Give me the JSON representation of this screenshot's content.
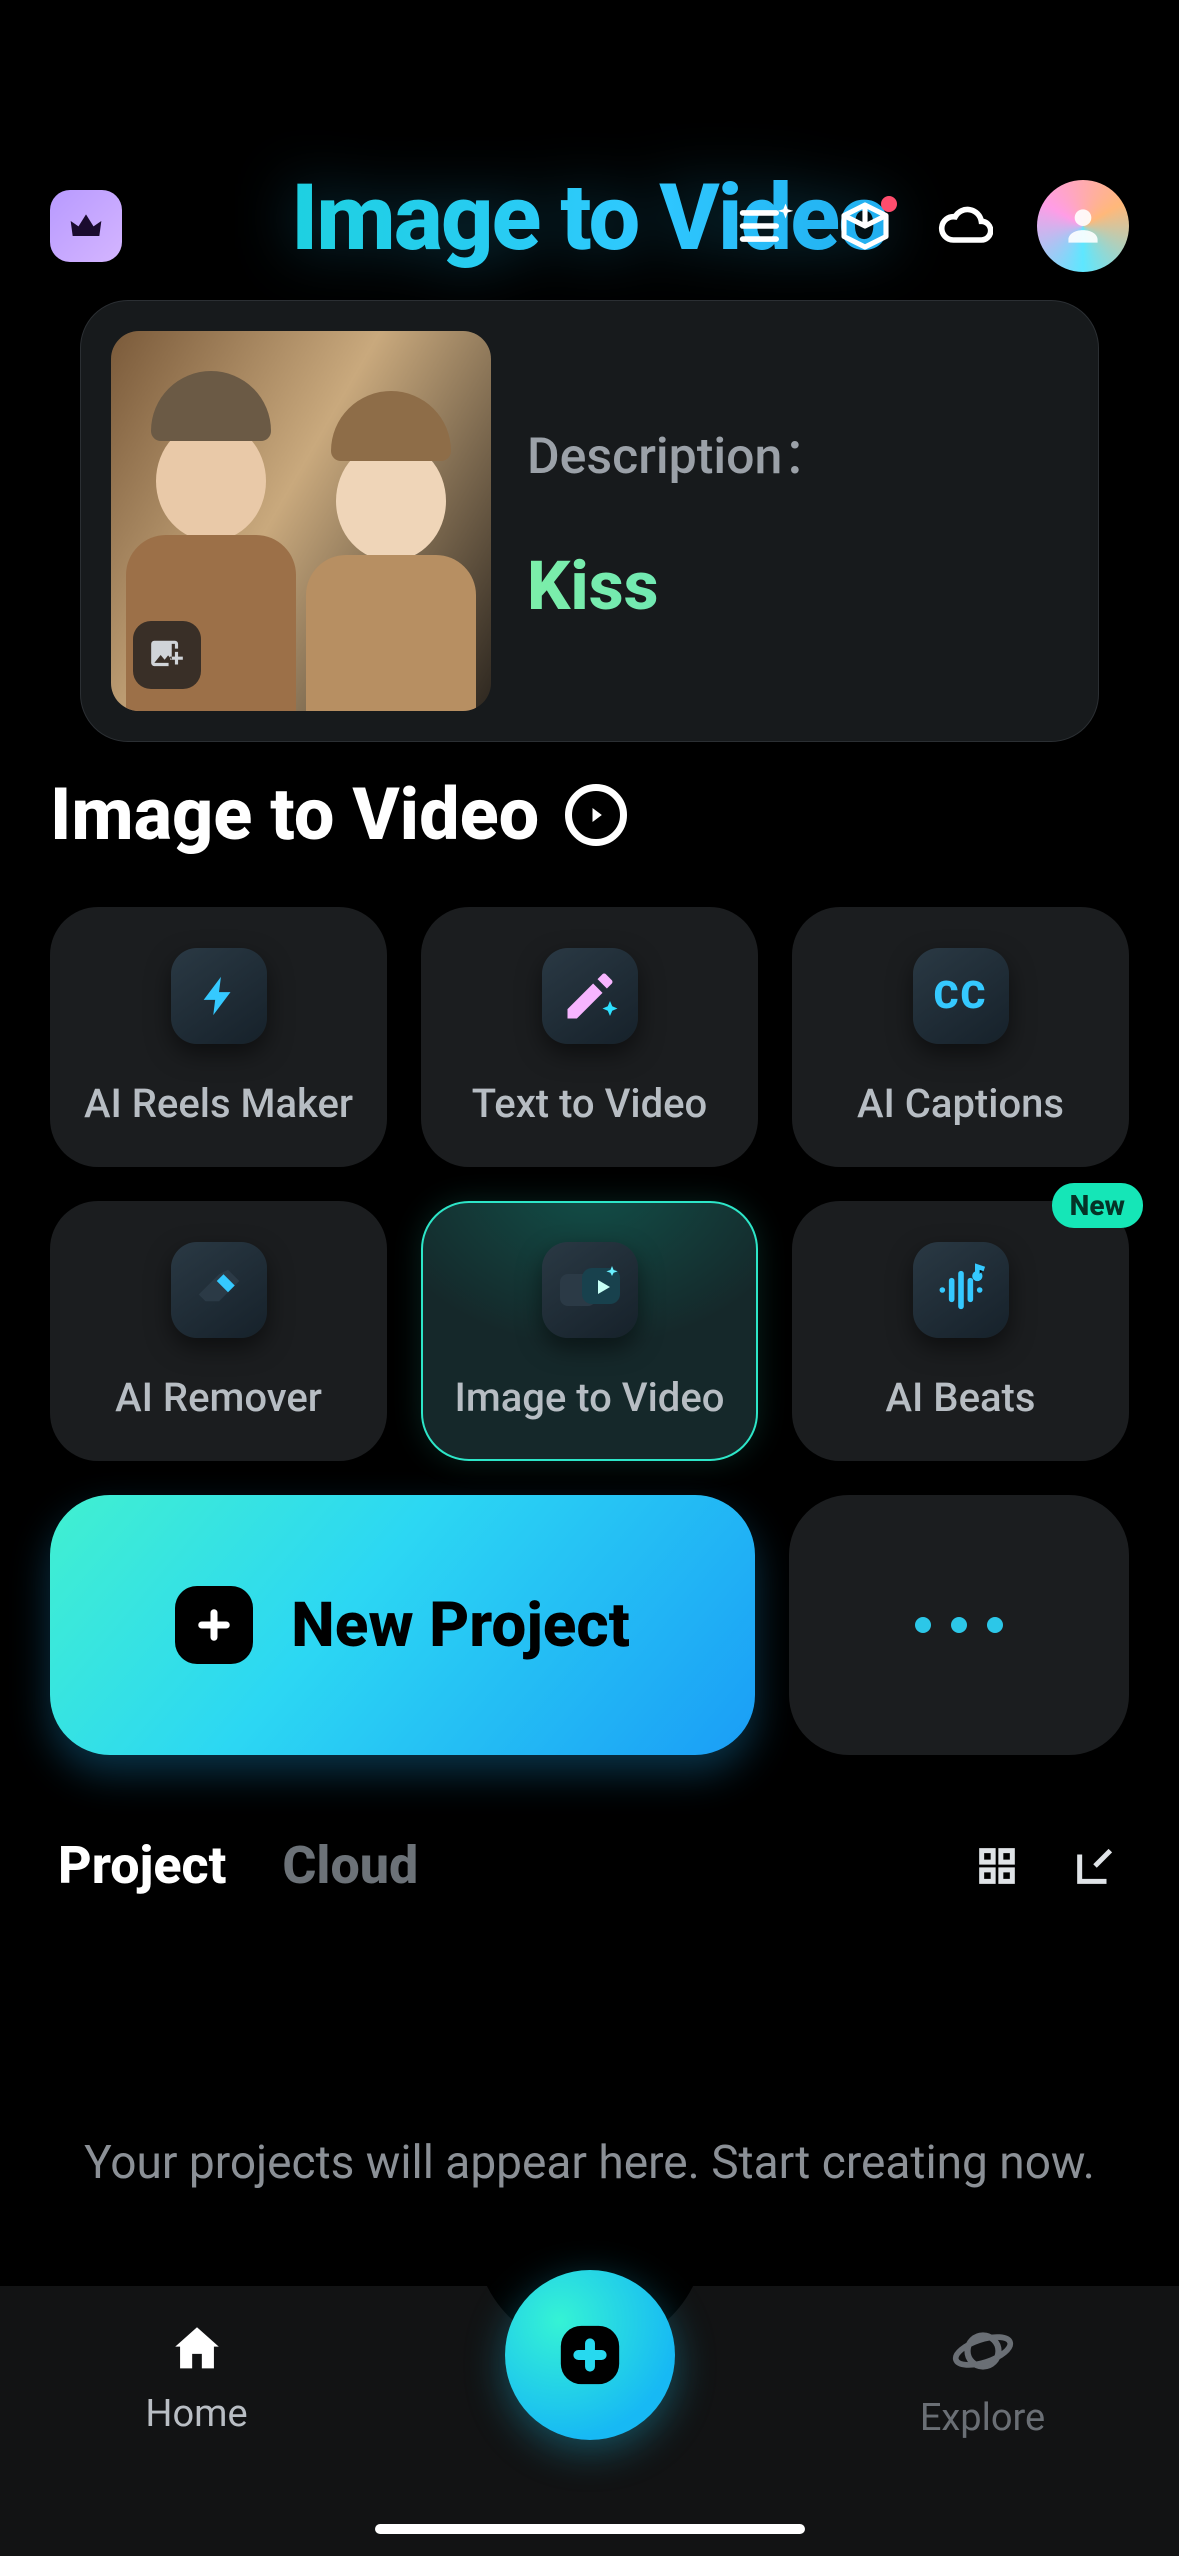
{
  "header": {
    "hero_title": "Image to Video"
  },
  "promo": {
    "description_label": "Description：",
    "description_value": "Kiss"
  },
  "subtitle": {
    "text": "Image to Video"
  },
  "features": [
    {
      "label": "AI Reels Maker",
      "icon": "bolt-icon",
      "active": false,
      "badge": null
    },
    {
      "label": "Text  to Video",
      "icon": "pencil-ai-icon",
      "active": false,
      "badge": null
    },
    {
      "label": "AI Captions",
      "icon": "cc-icon",
      "active": false,
      "badge": null
    },
    {
      "label": "AI Remover",
      "icon": "eraser-icon",
      "active": false,
      "badge": null
    },
    {
      "label": "Image to Video",
      "icon": "image-video-icon",
      "active": true,
      "badge": null
    },
    {
      "label": "AI Beats",
      "icon": "music-wave-icon",
      "active": false,
      "badge": "New"
    }
  ],
  "new_project": {
    "label": "New Project"
  },
  "tabs": {
    "items": [
      {
        "label": "Project",
        "active": true
      },
      {
        "label": "Cloud",
        "active": false
      }
    ]
  },
  "empty_state": "Your projects will appear here. Start creating now.",
  "bottom_nav": {
    "home": {
      "label": "Home"
    },
    "explore": {
      "label": "Explore"
    }
  },
  "colors": {
    "accent_gradient_start": "#41f0d0",
    "accent_gradient_end": "#1a9df6",
    "badge_new": "#15e6b7"
  }
}
